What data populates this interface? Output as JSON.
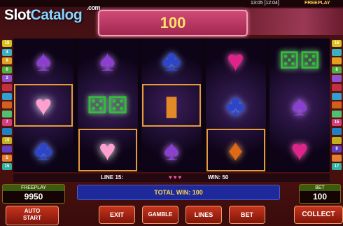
{
  "status_bar": {
    "clock": "13:05 [12:04]",
    "mode": "FREEPLAY"
  },
  "logo": {
    "part1": "Slot",
    "part2": "Catalog",
    "suffix": ".com"
  },
  "header": {
    "display_value": "100"
  },
  "line_indicators": {
    "left": [
      "18",
      "4",
      "8",
      "6",
      "2",
      "",
      "",
      "",
      "",
      "7",
      "",
      "19",
      "",
      "5",
      "15"
    ],
    "right": [
      "16",
      "",
      "",
      "8",
      "",
      "",
      "",
      "",
      "",
      "15",
      "",
      "",
      "9",
      "",
      "17"
    ]
  },
  "reels": [
    {
      "symbols": [
        {
          "icon": "spade-icon",
          "char": "♠",
          "cls": "spade"
        },
        {
          "icon": "heart-icon",
          "char": "♥",
          "cls": "heart-pink",
          "win": true
        },
        {
          "icon": "club-icon",
          "char": "♣",
          "cls": "club"
        }
      ]
    },
    {
      "symbols": [
        {
          "icon": "spade-icon",
          "char": "♠",
          "cls": "spade"
        },
        {
          "icon": "dice-icon",
          "char": "⚄⚄",
          "cls": "dice"
        },
        {
          "icon": "heart-icon",
          "char": "♥",
          "cls": "heart-pink",
          "win": true
        }
      ]
    },
    {
      "symbols": [
        {
          "icon": "club-icon",
          "char": "♣",
          "cls": "club"
        },
        {
          "icon": "bar-icon",
          "char": "▮",
          "cls": "bar",
          "win": true
        },
        {
          "icon": "spade-icon",
          "char": "♠",
          "cls": "spade"
        }
      ]
    },
    {
      "symbols": [
        {
          "icon": "heart-icon",
          "char": "♥",
          "cls": "heart-red"
        },
        {
          "icon": "club-icon",
          "char": "♣",
          "cls": "club"
        },
        {
          "icon": "diamond-icon",
          "char": "♦",
          "cls": "diamond",
          "win": true
        }
      ]
    },
    {
      "symbols": [
        {
          "icon": "dice-icon",
          "char": "⚄⚄",
          "cls": "dice"
        },
        {
          "icon": "spade-icon",
          "char": "♠",
          "cls": "spade"
        },
        {
          "icon": "heart-icon",
          "char": "♥",
          "cls": "heart-red"
        }
      ]
    }
  ],
  "info": {
    "line": "LINE 15:",
    "hearts": "♥♥♥",
    "win": "WIN: 50"
  },
  "freeplay": {
    "label": "FREEPLAY",
    "value": "9950"
  },
  "total_win": "TOTAL WIN: 100",
  "bet": {
    "label": "BET",
    "value": "100"
  },
  "buttons": {
    "auto_start_1": "AUTO",
    "auto_start_2": "START",
    "exit": "EXIT",
    "gamble": "GAMBLE",
    "lines": "LINES",
    "bet": "BET",
    "collect": "COLLECT"
  },
  "colors": {
    "accent": "#d04a78",
    "win_frame": "#e79a3c",
    "total_win_bg": "#1e2a9a"
  }
}
